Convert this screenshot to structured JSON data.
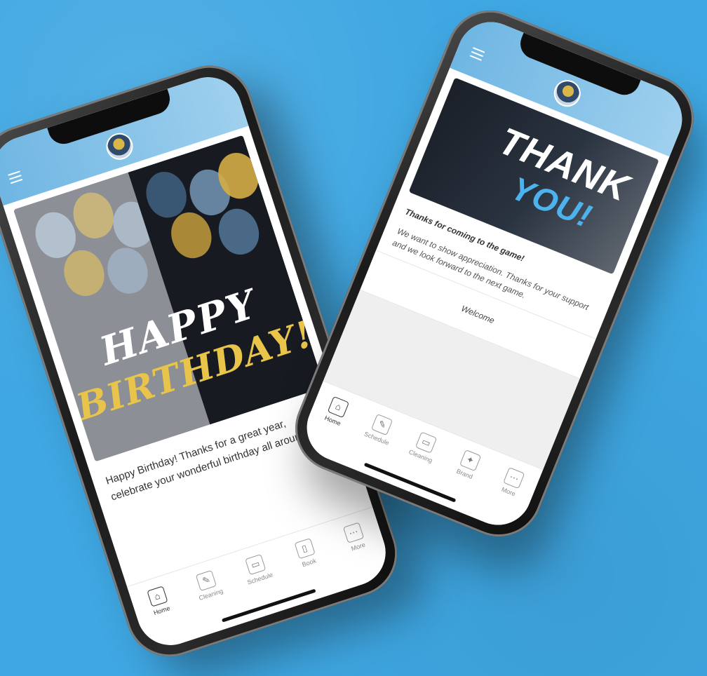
{
  "colors": {
    "background": "#3fa7e2",
    "header_gradient_start": "#6fb6e3",
    "birthday_gold": "#e8c44a",
    "thank_you_blue": "#4db3ee"
  },
  "left_phone": {
    "hero": {
      "line1": "HAPPY",
      "line2": "BIRTHDAY!"
    },
    "message": "Happy Birthday! Thanks for a great year, celebrate your wonderful birthday all around.",
    "tabs": [
      {
        "label": "Home",
        "icon": "home-icon",
        "glyph": "⌂",
        "active": true
      },
      {
        "label": "Cleaning",
        "icon": "cleaning-icon",
        "glyph": "✎",
        "active": false
      },
      {
        "label": "Schedule",
        "icon": "schedule-icon",
        "glyph": "▭",
        "active": false
      },
      {
        "label": "Book",
        "icon": "book-icon",
        "glyph": "▯",
        "active": false
      },
      {
        "label": "More",
        "icon": "more-icon",
        "glyph": "⋯",
        "active": false
      }
    ]
  },
  "right_phone": {
    "hero": {
      "line1": "THANK",
      "line2": "YOU!"
    },
    "message_strong": "Thanks for coming to the game!",
    "message_light": "We want to show appreciation. Thanks for your support and we look forward to the next game.",
    "signature": "Welcome",
    "tabs": [
      {
        "label": "Home",
        "icon": "home-icon",
        "glyph": "⌂",
        "active": true
      },
      {
        "label": "Schedule",
        "icon": "schedule-icon",
        "glyph": "✎",
        "active": false
      },
      {
        "label": "Cleaning",
        "icon": "cleaning-icon",
        "glyph": "▭",
        "active": false
      },
      {
        "label": "Brand",
        "icon": "brand-icon",
        "glyph": "✦",
        "active": false
      },
      {
        "label": "More",
        "icon": "more-icon",
        "glyph": "⋯",
        "active": false
      }
    ]
  }
}
